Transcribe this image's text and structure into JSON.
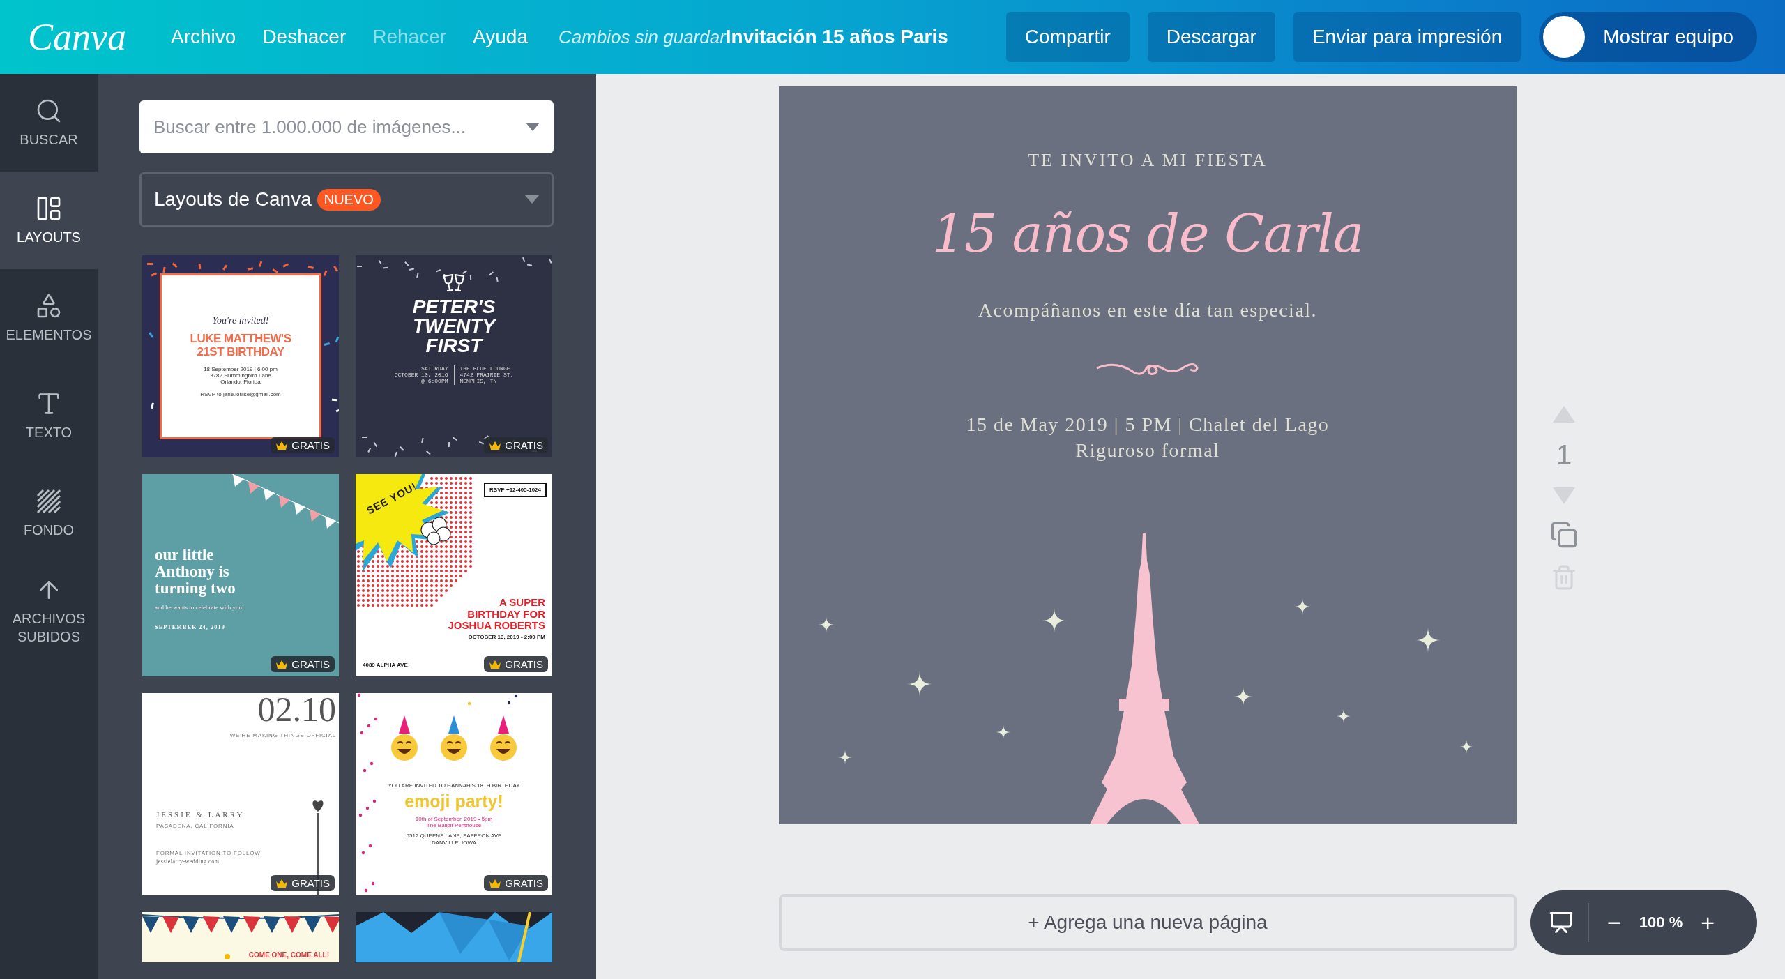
{
  "top_bar": {
    "logo": "Canva",
    "menu": [
      {
        "label": "Archivo",
        "disabled": false
      },
      {
        "label": "Deshacer",
        "disabled": false
      },
      {
        "label": "Rehacer",
        "disabled": true
      },
      {
        "label": "Ayuda",
        "disabled": false
      }
    ],
    "save_status": "Cambios sin guardar",
    "document_title": "Invitación 15 años Paris",
    "buttons": [
      "Compartir",
      "Descargar",
      "Enviar para impresión"
    ],
    "team_button": "Mostrar equipo"
  },
  "sidebar": {
    "items": [
      {
        "kind": "search",
        "label": "BUSCAR",
        "selected": false
      },
      {
        "kind": "layouts",
        "label": "LAYOUTS",
        "selected": true
      },
      {
        "kind": "elements",
        "label": "ELEMENTOS",
        "selected": false
      },
      {
        "kind": "text",
        "label": "TEXTO",
        "selected": false
      },
      {
        "kind": "background",
        "label": "FONDO",
        "selected": false
      },
      {
        "kind": "uploads",
        "label": "ARCHIVOS SUBIDOS",
        "selected": false
      }
    ]
  },
  "panel": {
    "search": {
      "placeholder": "Buscar entre 1.000.000 de imágenes..."
    },
    "category": {
      "value": "Layouts de Canva",
      "badge": "NUEVO"
    },
    "templates": [
      {
        "kind": "confetti",
        "badge": "GRATIS",
        "lines": [
          "You're invited!",
          "LUKE MATTHEW'S",
          "21ST BIRTHDAY",
          "18 September 2019 | 6:00 pm",
          "3782 Hummingbird Lane",
          "Orlando, Florida",
          "RSVP to jane.louise@gmail.com"
        ]
      },
      {
        "kind": "toast",
        "badge": "GRATIS",
        "lines": [
          "PETER'S",
          "TWENTY",
          "FIRST",
          "SATURDAY",
          "OCTOBER 10, 2016",
          "@ 6:00PM",
          "THE BLUE LOUNGE",
          "4742 PRAIRIE ST.",
          "MEMPHIS, TN"
        ]
      },
      {
        "kind": "bunting",
        "badge": "GRATIS",
        "lines": [
          "our little",
          "Anthony is",
          "turning two",
          "and he wants to celebrate with you!",
          "SEPTEMBER 24, 2019"
        ]
      },
      {
        "kind": "comic",
        "badge": "GRATIS",
        "lines": [
          "SEE YOU!",
          "RSVP +12-405-1024",
          "A SUPER",
          "BIRTHDAY FOR",
          "JOSHUA ROBERTS",
          "OCTOBER 13, 2019 - 2:00 PM",
          "4089 ALPHA AVE"
        ]
      },
      {
        "kind": "minimal",
        "badge": "GRATIS",
        "lines": [
          "02.10",
          "WE'RE MAKING THINGS OFFICIAL",
          "JESSIE & LARRY",
          "PASADENA, CALIFORNIA",
          "FORMAL INVITATION TO FOLLOW",
          "jessielarry-wedding.com"
        ]
      },
      {
        "kind": "emoji",
        "badge": "GRATIS",
        "lines": [
          "YOU ARE INVITED TO HANNAH'S 18TH BIRTHDAY",
          "emoji party!",
          "10th of September, 2019 • 5pm",
          "The Ballpit Penthouse",
          "5512 QUEENS LANE, SAFFRON AVE",
          "DANVILLE, IOWA"
        ]
      },
      {
        "kind": "banner",
        "lines": [
          "COME ONE, COME ALL!"
        ]
      },
      {
        "kind": "burst"
      }
    ]
  },
  "design": {
    "eyebrow": "TE INVITO A MI FIESTA",
    "title": "15 años de Carla",
    "subtitle": "Acompáñanos en este día tan especial.",
    "details": [
      "15 de May 2019 | 5 PM | Chalet del Lago",
      "Riguroso formal"
    ]
  },
  "page_controls": {
    "number": "1",
    "actions": [
      {
        "kind": "up",
        "disabled": true
      },
      {
        "kind": "down",
        "disabled": true
      },
      {
        "kind": "copy",
        "disabled": false
      },
      {
        "kind": "delete",
        "disabled": true
      }
    ]
  },
  "add_page": "+ Agrega una nueva página",
  "zoom": {
    "minus": "−",
    "value": "100 %",
    "plus": "+"
  }
}
